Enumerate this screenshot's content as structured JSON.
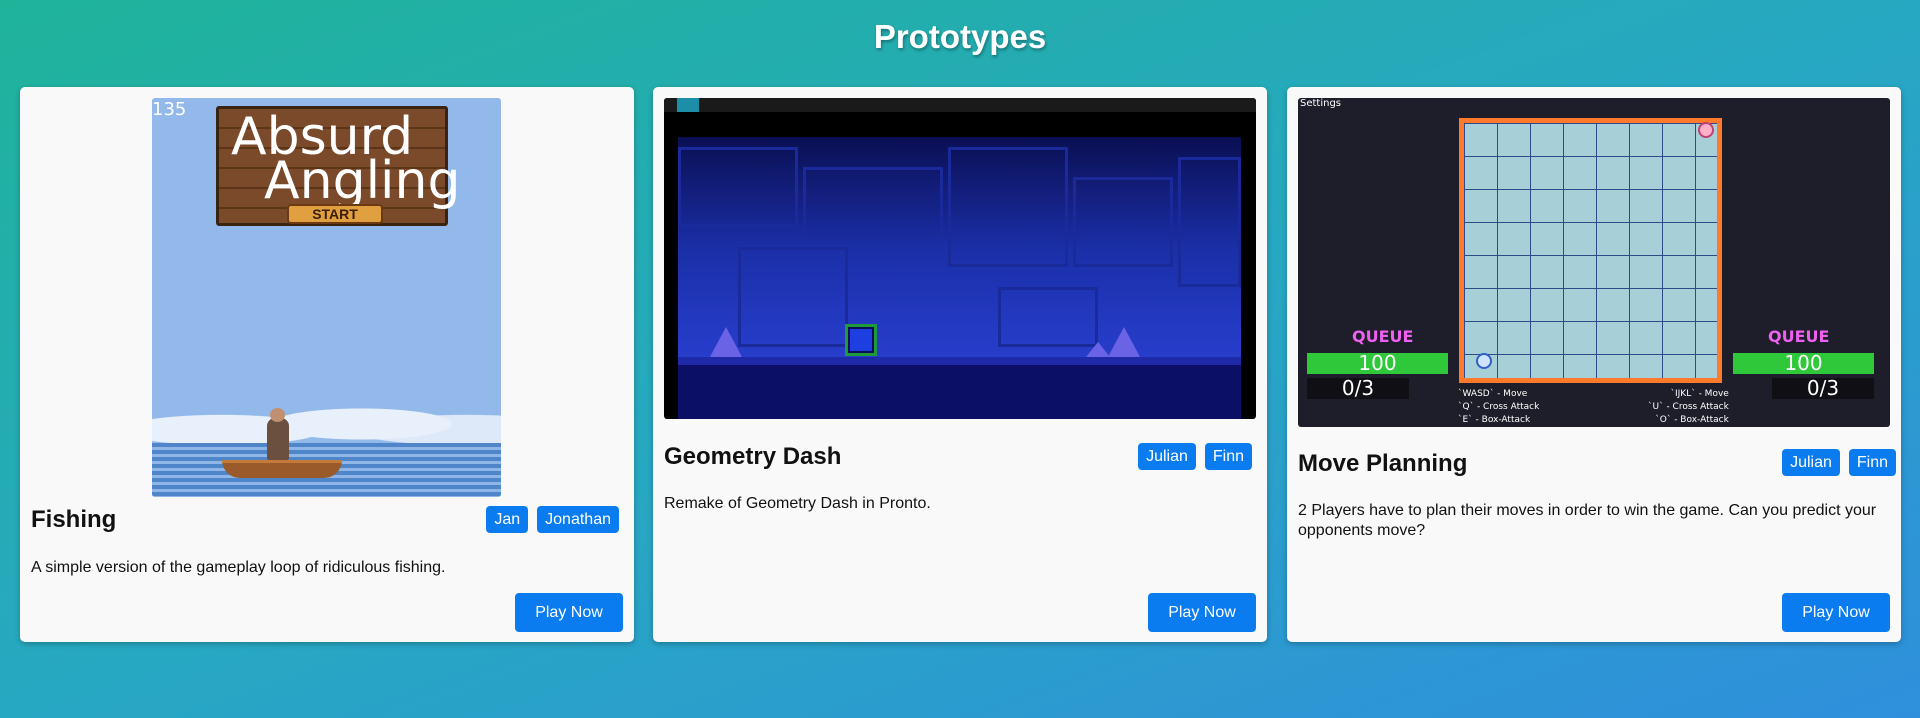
{
  "page": {
    "title": "Prototypes"
  },
  "cards": [
    {
      "title": "Fishing",
      "authors": [
        "Jan",
        "Jonathan"
      ],
      "description": "A simple version of the gameplay loop of ridiculous fishing.",
      "button": "Play Now",
      "thumbnail": {
        "counter": "135",
        "game_title": "Absurd\n  Angling",
        "start_label": "START"
      }
    },
    {
      "title": "Geometry Dash",
      "authors": [
        "Julian",
        "Finn"
      ],
      "description": "Remake of Geometry Dash in Pronto.",
      "button": "Play Now"
    },
    {
      "title": "Move Planning",
      "authors": [
        "Julian",
        "Finn"
      ],
      "description": "2 Players have to plan their moves in order to win the game. Can you predict your opponents move?",
      "button": "Play Now",
      "thumbnail": {
        "settings_label": "Settings",
        "left_queue": "QUEUE",
        "left_hp": "100",
        "left_count": "0/3",
        "right_queue": "QUEUE",
        "right_hp": "100",
        "right_count": "0/3",
        "left_help": "`WASD` - Move\n`Q` - Cross Attack\n`E` - Box-Attack",
        "right_help": "`IJKL` - Move\n`U` - Cross Attack\n`O` - Box-Attack"
      }
    }
  ],
  "colors": {
    "accent": "#0a7cf0",
    "card_bg": "#f9f9f9"
  }
}
